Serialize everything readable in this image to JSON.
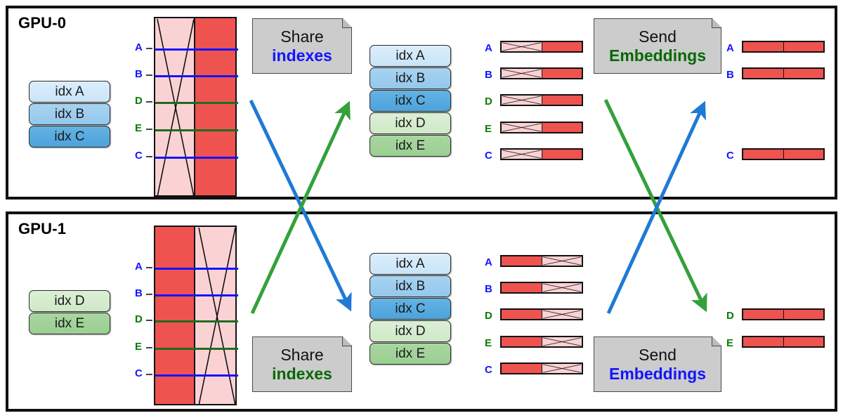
{
  "panels": [
    {
      "id": "gpu0",
      "title": "GPU-0",
      "local_indexes": [
        {
          "label": "idx A",
          "tone": "bl1"
        },
        {
          "label": "idx B",
          "tone": "bl2"
        },
        {
          "label": "idx C",
          "tone": "bl3"
        }
      ],
      "table": {
        "left_fill": "pink_crossed",
        "right_fill": "red",
        "rows": [
          {
            "label": "A",
            "color": "blue"
          },
          {
            "label": "B",
            "color": "blue"
          },
          {
            "label": "D",
            "color": "green"
          },
          {
            "label": "E",
            "color": "green"
          },
          {
            "label": "C",
            "color": "blue"
          }
        ]
      },
      "note": {
        "line1": "Share",
        "line2": "indexes",
        "line2_color": "blue"
      },
      "all_indexes": [
        {
          "label": "idx A",
          "tone": "bl1"
        },
        {
          "label": "idx B",
          "tone": "bl2"
        },
        {
          "label": "idx C",
          "tone": "bl3"
        },
        {
          "label": "idx D",
          "tone": "gr1"
        },
        {
          "label": "idx E",
          "tone": "gr2"
        }
      ],
      "embeddings_left": [
        {
          "label": "A",
          "color": "blue",
          "left": "pink_crossed",
          "right": "red"
        },
        {
          "label": "B",
          "color": "blue",
          "left": "pink_crossed",
          "right": "red"
        },
        {
          "label": "D",
          "color": "green",
          "left": "pink_crossed",
          "right": "red"
        },
        {
          "label": "E",
          "color": "green",
          "left": "pink_crossed",
          "right": "red"
        },
        {
          "label": "C",
          "color": "blue",
          "left": "pink_crossed",
          "right": "red"
        }
      ],
      "note2": {
        "line1": "Send",
        "line2": "Embeddings",
        "line2_color": "green"
      },
      "embeddings_right": [
        {
          "label": "A",
          "color": "blue",
          "left": "red",
          "right": "red"
        },
        {
          "label": "B",
          "color": "blue",
          "left": "red",
          "right": "red"
        },
        {
          "label": "C",
          "color": "blue",
          "left": "red",
          "right": "red"
        }
      ]
    },
    {
      "id": "gpu1",
      "title": "GPU-1",
      "local_indexes": [
        {
          "label": "idx D",
          "tone": "gr1"
        },
        {
          "label": "idx E",
          "tone": "gr2"
        }
      ],
      "table": {
        "left_fill": "red",
        "right_fill": "pink_crossed",
        "rows": [
          {
            "label": "A",
            "color": "blue"
          },
          {
            "label": "B",
            "color": "blue"
          },
          {
            "label": "D",
            "color": "green"
          },
          {
            "label": "E",
            "color": "green"
          },
          {
            "label": "C",
            "color": "blue"
          }
        ]
      },
      "note": {
        "line1": "Share",
        "line2": "indexes",
        "line2_color": "green"
      },
      "all_indexes": [
        {
          "label": "idx A",
          "tone": "bl1"
        },
        {
          "label": "idx B",
          "tone": "bl2"
        },
        {
          "label": "idx C",
          "tone": "bl3"
        },
        {
          "label": "idx D",
          "tone": "gr1"
        },
        {
          "label": "idx E",
          "tone": "gr2"
        }
      ],
      "embeddings_left": [
        {
          "label": "A",
          "color": "blue",
          "left": "red",
          "right": "pink_crossed"
        },
        {
          "label": "B",
          "color": "blue",
          "left": "red",
          "right": "pink_crossed"
        },
        {
          "label": "D",
          "color": "green",
          "left": "red",
          "right": "pink_crossed"
        },
        {
          "label": "E",
          "color": "green",
          "left": "red",
          "right": "pink_crossed"
        },
        {
          "label": "C",
          "color": "blue",
          "left": "red",
          "right": "pink_crossed"
        }
      ],
      "note2": {
        "line1": "Send",
        "line2": "Embeddings",
        "line2_color": "blue"
      },
      "embeddings_right": [
        {
          "label": "D",
          "color": "green",
          "left": "red",
          "right": "red"
        },
        {
          "label": "E",
          "color": "green",
          "left": "red",
          "right": "red"
        }
      ]
    }
  ],
  "arrows": [
    {
      "name": "share-indexes-gpu0-to-gpu1",
      "color": "#1f7ad4"
    },
    {
      "name": "share-indexes-gpu1-to-gpu0",
      "color": "#34a13a"
    },
    {
      "name": "send-embeddings-gpu0-to-gpu1",
      "color": "#34a13a"
    },
    {
      "name": "send-embeddings-gpu1-to-gpu0",
      "color": "#1f7ad4"
    }
  ],
  "colors": {
    "blue_text": "#1414ff",
    "green_text": "#0a7a0a",
    "red_fill": "#ef5350",
    "pink_fill": "#fbd2d4",
    "note_bg": "#cccccc",
    "arrow_blue": "#1f7ad4",
    "arrow_green": "#34a13a"
  }
}
